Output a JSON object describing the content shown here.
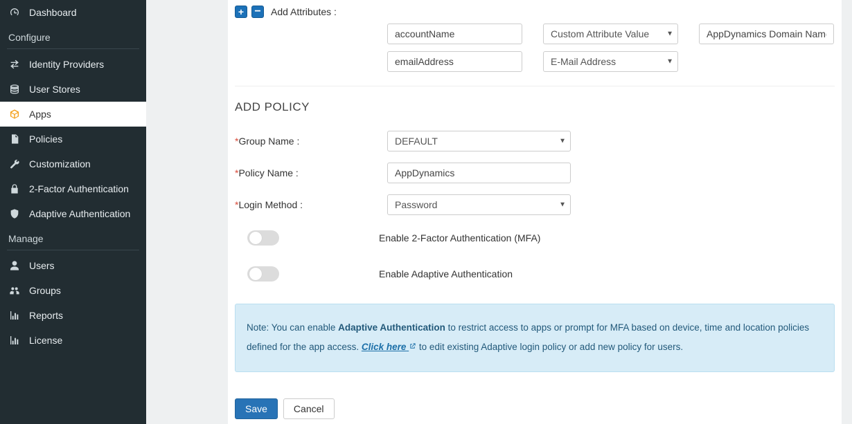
{
  "sidebar": {
    "top": [
      {
        "icon": "gauge-icon",
        "label": "Dashboard"
      }
    ],
    "configure_header": "Configure",
    "configure": [
      {
        "icon": "swap-icon",
        "label": "Identity Providers"
      },
      {
        "icon": "db-icon",
        "label": "User Stores"
      },
      {
        "icon": "cube-icon",
        "label": "Apps",
        "active": true
      },
      {
        "icon": "doc-icon",
        "label": "Policies"
      },
      {
        "icon": "wrench-icon",
        "label": "Customization"
      },
      {
        "icon": "lock-icon",
        "label": "2-Factor Authentication"
      },
      {
        "icon": "shield-icon",
        "label": "Adaptive Authentication"
      }
    ],
    "manage_header": "Manage",
    "manage": [
      {
        "icon": "user-icon",
        "label": "Users"
      },
      {
        "icon": "users-icon",
        "label": "Groups"
      },
      {
        "icon": "chart-icon",
        "label": "Reports"
      },
      {
        "icon": "chart-icon",
        "label": "License"
      }
    ]
  },
  "attributes": {
    "title": "Add Attributes :",
    "rows": [
      {
        "name": "accountName",
        "type": "Custom Attribute Value",
        "domain": "AppDynamics Domain Name"
      },
      {
        "name": "emailAddress",
        "type": "E-Mail Address"
      }
    ]
  },
  "policy": {
    "heading": "ADD POLICY",
    "fields": {
      "group_label": "Group Name :",
      "group_value": "DEFAULT",
      "policy_label": "Policy Name :",
      "policy_value": "AppDynamics",
      "login_label": "Login Method :",
      "login_value": "Password"
    },
    "toggles": {
      "mfa": "Enable 2-Factor Authentication (MFA)",
      "adaptive": "Enable Adaptive Authentication"
    },
    "note": {
      "prefix": "Note: You can enable ",
      "bold": "Adaptive Authentication",
      "mid": " to restrict access to apps or prompt for MFA based on device, time and location policies defined for the app access. ",
      "link": "Click here",
      "suffix": " to edit existing Adaptive login policy or add new policy for users."
    }
  },
  "buttons": {
    "save": "Save",
    "cancel": "Cancel"
  }
}
